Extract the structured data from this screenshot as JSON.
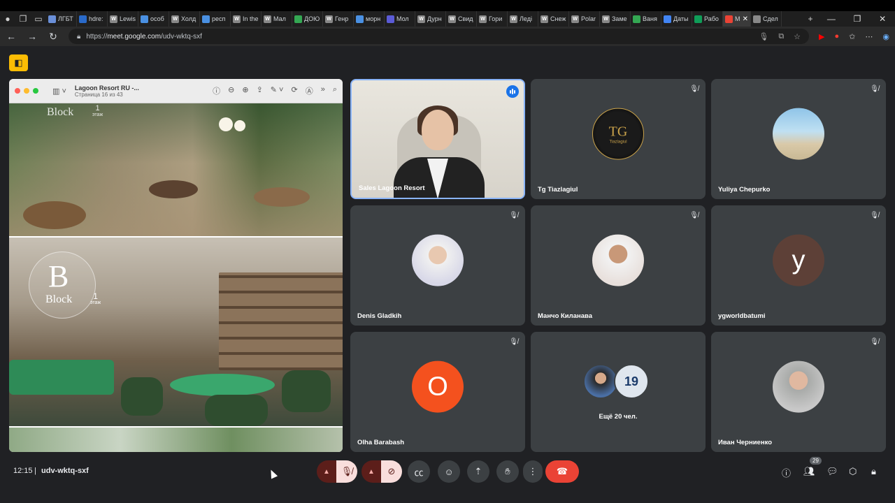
{
  "browser": {
    "tabs": [
      {
        "label": "ЛГБТ",
        "icon": "generic",
        "color": "#6a8fd8"
      },
      {
        "label": "hdre:",
        "icon": "site",
        "color": "#2a6ac9"
      },
      {
        "label": "Lewis",
        "icon": "wiki",
        "color": "#888"
      },
      {
        "label": "особ",
        "icon": "ring",
        "color": "#4a90e2"
      },
      {
        "label": "Холд",
        "icon": "wiki",
        "color": "#888"
      },
      {
        "label": "респ",
        "icon": "ring",
        "color": "#4a90e2"
      },
      {
        "label": "In the",
        "icon": "wiki",
        "color": "#888"
      },
      {
        "label": "Мал",
        "icon": "wiki",
        "color": "#888"
      },
      {
        "label": "ДОЮ",
        "icon": "drive",
        "color": "#34a853"
      },
      {
        "label": "Генр",
        "icon": "wiki",
        "color": "#888"
      },
      {
        "label": "морн",
        "icon": "ring",
        "color": "#4a90e2"
      },
      {
        "label": "Мол",
        "icon": "ring",
        "color": "#5b5bd6"
      },
      {
        "label": "Дурн",
        "icon": "wiki",
        "color": "#888"
      },
      {
        "label": "Свид",
        "icon": "wiki",
        "color": "#888"
      },
      {
        "label": "Гори",
        "icon": "wiki",
        "color": "#888"
      },
      {
        "label": "Леді",
        "icon": "wiki",
        "color": "#888"
      },
      {
        "label": "Снеж",
        "icon": "wiki",
        "color": "#888"
      },
      {
        "label": "Polar",
        "icon": "wiki",
        "color": "#888"
      },
      {
        "label": "Заме",
        "icon": "wiki",
        "color": "#888"
      },
      {
        "label": "Ваня",
        "icon": "drive",
        "color": "#34a853"
      },
      {
        "label": "Даты",
        "icon": "docs",
        "color": "#4285f4"
      },
      {
        "label": "Рабо",
        "icon": "sheets",
        "color": "#0f9d58"
      },
      {
        "label": "M",
        "icon": "record",
        "color": "#ea4335",
        "active": true
      },
      {
        "label": "Сдел",
        "icon": "site",
        "color": "#888"
      }
    ],
    "new_tab": "+",
    "url_prefix": "https://",
    "url_host": "meet.google.com",
    "url_path": "/udv-wktq-sxf"
  },
  "presentation": {
    "doc_title": "Lagoon Resort RU -...",
    "doc_page": "Страница 16 из 43",
    "slide1": {
      "word": "Block",
      "floor_num": "1",
      "floor_word": "этаж"
    },
    "slide2": {
      "letter": "B",
      "word": "Block",
      "floor_num": "1",
      "floor_word": "этаж"
    }
  },
  "participants": [
    {
      "name": "Sales Lagoon Resort",
      "active": true,
      "speaking": true
    },
    {
      "name": "Tg Tiazlagiul",
      "muted": true,
      "avatar_text": "TG",
      "avatar_sub": "Tiazlagiul"
    },
    {
      "name": "Yuliya Chepurko",
      "muted": true
    },
    {
      "name": "Denis Gladkih",
      "muted": true
    },
    {
      "name": "Манчо Киланава",
      "muted": true
    },
    {
      "name": "ygworldbatumi",
      "muted": true,
      "avatar_letter": "y",
      "avatar_color": "#5d4037"
    },
    {
      "name": "Olha Barabash",
      "muted": true,
      "avatar_letter": "O",
      "avatar_color": "#f4511e"
    },
    {
      "more_label": "Ещё 20 чел.",
      "jersey": "19"
    },
    {
      "name": "Иван Черниенко",
      "muted": true
    }
  ],
  "bottom_bar": {
    "time": "12:15",
    "meeting_code": "udv-wktq-sxf",
    "participant_count": "29"
  },
  "colors": {
    "accent": "#8ab4f8",
    "end_call": "#ea4335",
    "mic_off_bg": "#f9dedc",
    "meet_logo": "#fbbc04"
  }
}
